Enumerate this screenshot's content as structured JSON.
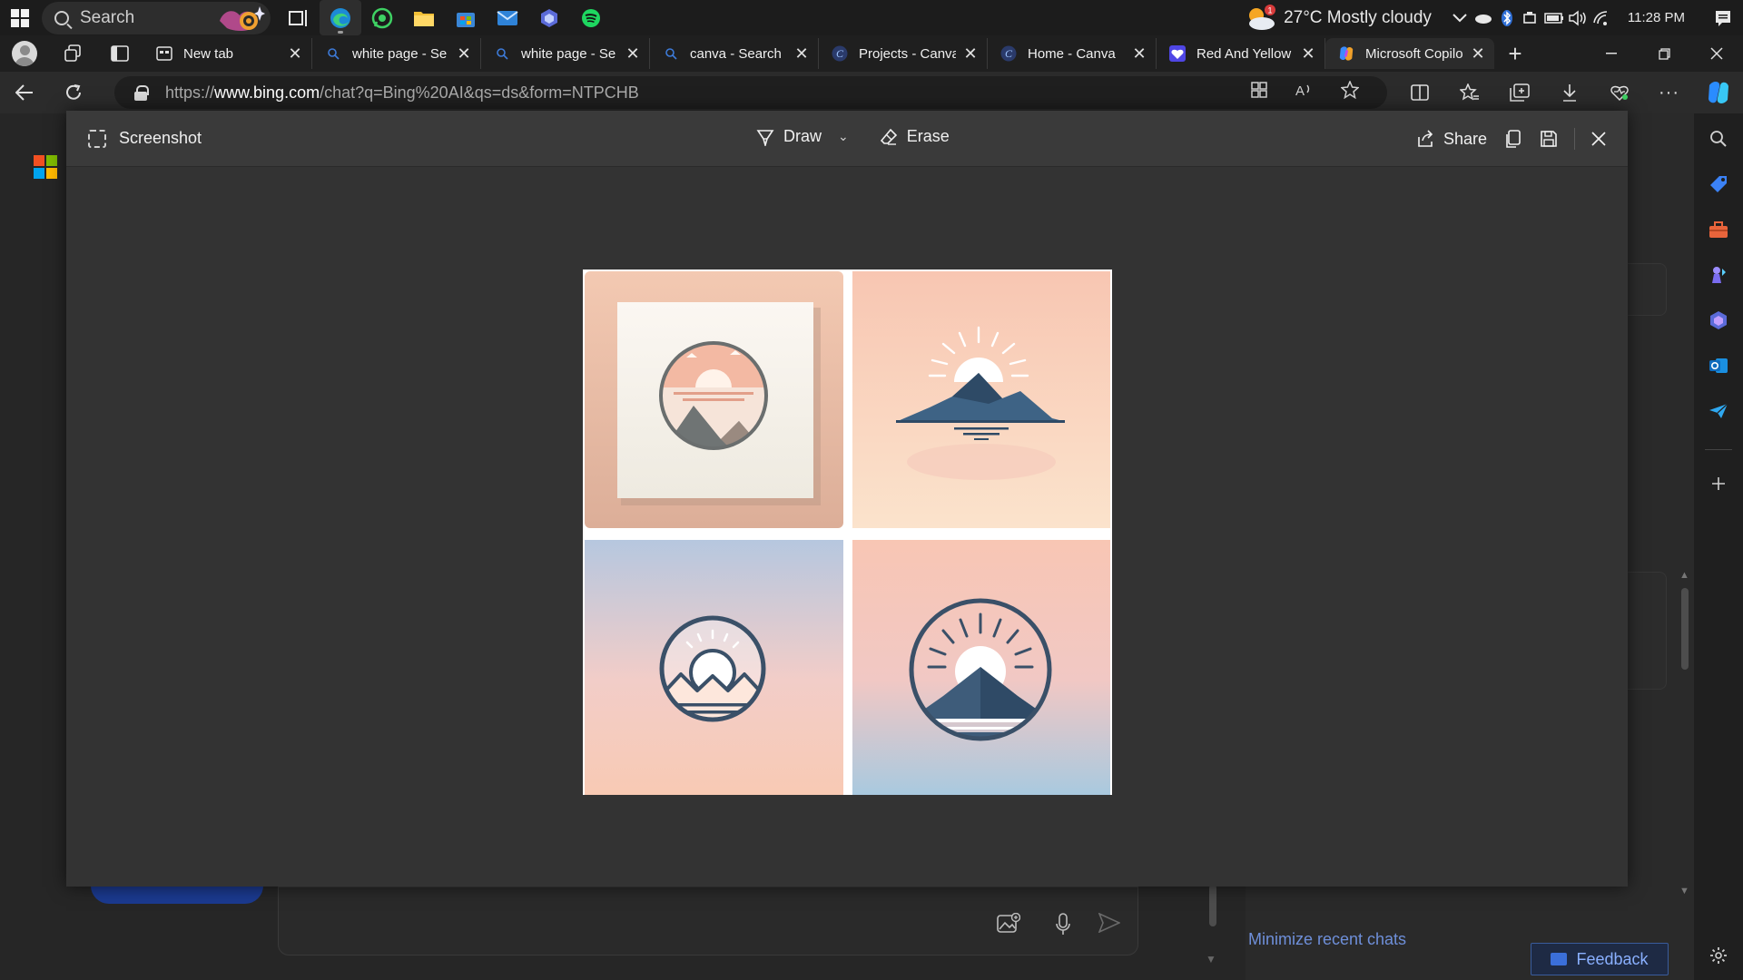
{
  "taskbar": {
    "search_label": "Search",
    "apps": [
      "task-view",
      "edge",
      "whatsapp",
      "file-explorer",
      "microsoft-store",
      "mail",
      "copilot",
      "spotify"
    ],
    "weather": {
      "text": "27°C  Mostly cloudy",
      "badge": "1"
    },
    "clock": "11:28 PM"
  },
  "tabs": [
    {
      "label": "New tab",
      "icon": "newtab-icon"
    },
    {
      "label": "white page - Se",
      "icon": "search-icon"
    },
    {
      "label": "white page - Se",
      "icon": "search-icon"
    },
    {
      "label": "canva - Search",
      "icon": "search-icon"
    },
    {
      "label": "Projects - Canva",
      "icon": "canva-icon"
    },
    {
      "label": "Home - Canva",
      "icon": "canva-icon"
    },
    {
      "label": "Red And Yellow",
      "icon": "heart-icon"
    },
    {
      "label": "Microsoft Copilo",
      "icon": "copilot-icon"
    }
  ],
  "address": {
    "prefix": "https://",
    "host": "www.bing.com",
    "path": "/chat?q=Bing%20AI&qs=ds&form=NTPCHB"
  },
  "screenshot": {
    "title": "Screenshot",
    "draw_label": "Draw",
    "erase_label": "Erase",
    "share_label": "Share"
  },
  "background": {
    "minimize_recent": "Minimize recent chats",
    "feedback": "Feedback"
  },
  "colors": {
    "accent": "#3b6fd9",
    "peach": "#f6cbb6",
    "navy": "#3a5068",
    "sky": "#b6c7df"
  }
}
